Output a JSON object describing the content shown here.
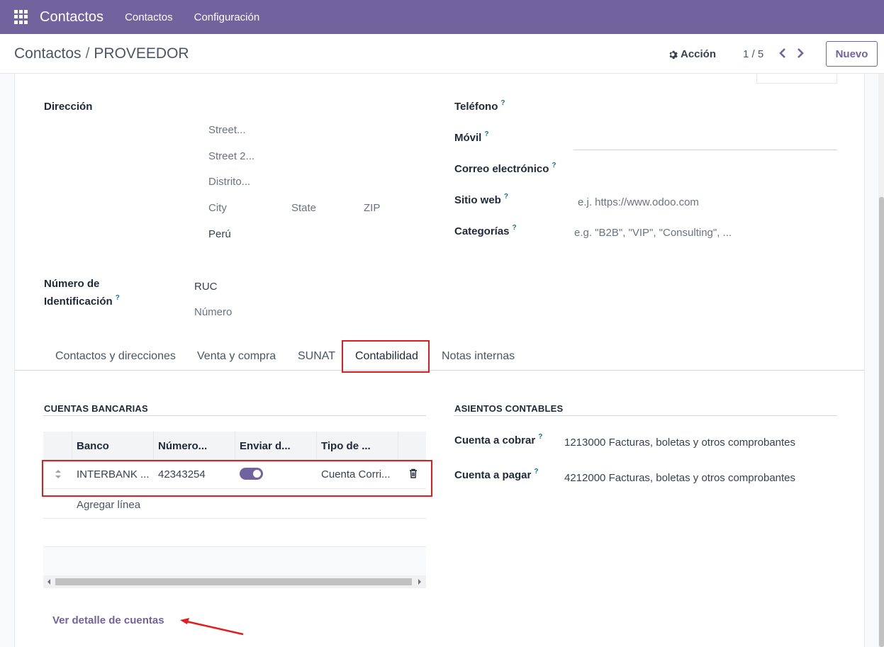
{
  "navbar": {
    "app_name": "Contactos",
    "menu": [
      "Contactos",
      "Configuración"
    ]
  },
  "control_panel": {
    "breadcrumb_parent": "Contactos",
    "breadcrumb_separator": "/",
    "breadcrumb_current": "PROVEEDOR",
    "action_label": "Acción",
    "pager": "1 / 5",
    "new_button": "Nuevo"
  },
  "address": {
    "label": "Dirección",
    "street_placeholder": "Street...",
    "street2_placeholder": "Street 2...",
    "district_placeholder": "Distrito...",
    "city_placeholder": "City",
    "state_placeholder": "State",
    "zip_placeholder": "ZIP",
    "country": "Perú"
  },
  "identification": {
    "label_line1": "Número de",
    "label_line2": "Identificación",
    "type": "RUC",
    "number_placeholder": "Número"
  },
  "contact_info": {
    "phone_label": "Teléfono",
    "mobile_label": "Móvil",
    "email_label": "Correo electrónico",
    "website_label": "Sitio web",
    "website_placeholder": "e.j. https://www.odoo.com",
    "tags_label": "Categorías",
    "tags_placeholder": "e.g. \"B2B\", \"VIP\", \"Consulting\", ..."
  },
  "help_mark": "?",
  "tabs": [
    "Contactos y direcciones",
    "Venta y compra",
    "SUNAT",
    "Contabilidad",
    "Notas internas"
  ],
  "bank_accounts": {
    "title": "CUENTAS BANCARIAS",
    "columns": [
      "Banco",
      "Número...",
      "Enviar d...",
      "Tipo de ..."
    ],
    "rows": [
      {
        "bank": "INTERBANK ...",
        "number": "42343254",
        "send_enabled": true,
        "type": "Cuenta Corri..."
      }
    ],
    "add_line": "Agregar línea"
  },
  "journal_entries": {
    "title": "ASIENTOS CONTABLES",
    "receivable_label": "Cuenta a cobrar",
    "receivable_value": "1213000 Facturas, boletas y otros comprobantes",
    "payable_label": "Cuenta a pagar",
    "payable_value": "4212000 Facturas, boletas y otros comprobantes"
  },
  "details_link": "Ver detalle de cuentas",
  "colors": {
    "brand": "#71639e",
    "annotation": "#e11d1d"
  }
}
